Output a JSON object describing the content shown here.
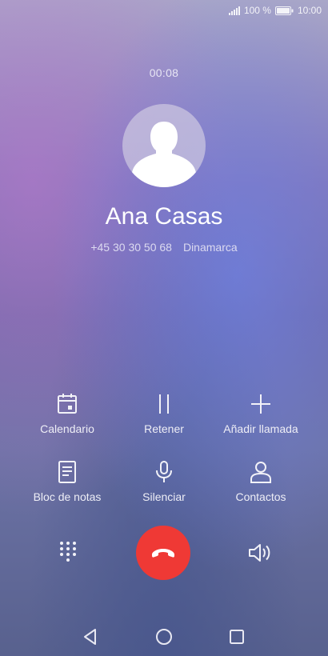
{
  "status_bar": {
    "battery_percent": "100 %",
    "time": "10:00",
    "signal_icon": "signal-bars-icon",
    "battery_icon": "battery-full-icon"
  },
  "call": {
    "timer": "00:08",
    "contact_name": "Ana Casas",
    "phone_number": "+45 30 30 50 68",
    "country": "Dinamarca",
    "avatar_icon": "person-silhouette-icon"
  },
  "actions": [
    {
      "label": "Calendario",
      "icon": "calendar-icon"
    },
    {
      "label": "Retener",
      "icon": "pause-icon"
    },
    {
      "label": "Añadir llamada",
      "icon": "plus-icon"
    },
    {
      "label": "Bloc de notas",
      "icon": "notes-icon"
    },
    {
      "label": "Silenciar",
      "icon": "microphone-icon"
    },
    {
      "label": "Contactos",
      "icon": "contacts-icon"
    }
  ],
  "controls": {
    "dialpad_icon": "dialpad-icon",
    "end_call_icon": "end-call-icon",
    "speaker_icon": "speaker-icon",
    "end_call_color": "#ef3935"
  },
  "navigation": {
    "back_icon": "back-triangle-icon",
    "home_icon": "home-circle-icon",
    "recents_icon": "recents-square-icon"
  }
}
